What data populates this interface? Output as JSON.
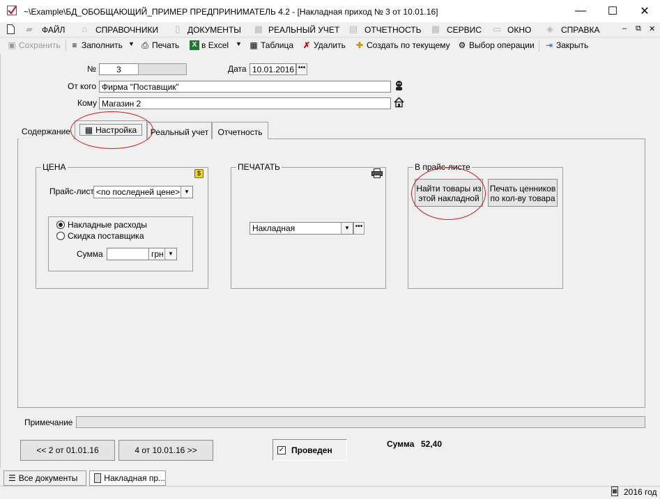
{
  "window": {
    "title": "~\\Example\\БД_ОБОБЩАЮЩИЙ_ПРИМЕР  ПРЕДПРИНИМАТЕЛЬ 4.2 - [Накладная приход № 3 от 10.01.16]",
    "minimize": "—",
    "maximize": "☐",
    "close": "✕"
  },
  "menu": {
    "items": [
      {
        "label": "ФАЙЛ"
      },
      {
        "label": "СПРАВОЧНИКИ"
      },
      {
        "label": "ДОКУМЕНТЫ"
      },
      {
        "label": "РЕАЛЬНЫЙ УЧЕТ"
      },
      {
        "label": "ОТЧЕТНОСТЬ"
      },
      {
        "label": "СЕРВИС"
      },
      {
        "label": "ОКНО"
      },
      {
        "label": "СПРАВКА"
      }
    ],
    "mdi_minimize": "–",
    "mdi_restore": "⧉",
    "mdi_close": "✕"
  },
  "toolbar": {
    "save": "Сохранить",
    "fill": "Заполнить",
    "print": "Печать",
    "excel": "в Excel",
    "table": "Таблица",
    "delete": "Удалить",
    "create": "Создать по текущему",
    "select_op": "Выбор операции",
    "close": "Закрыть"
  },
  "form": {
    "number_label": "№",
    "number_value": "3",
    "date_label": "Дата",
    "date_value": "10.01.2016",
    "from_label": "От кого",
    "from_value": "Фирма \"Поставщик\"",
    "to_label": "Кому",
    "to_value": "Магазин 2"
  },
  "tabs": [
    {
      "label": "Содержание"
    },
    {
      "label": "Настройка"
    },
    {
      "label": "Реальный учет"
    },
    {
      "label": "Отчетность"
    }
  ],
  "price_group": {
    "title": "ЦЕНА",
    "pricelist_label": "Прайс-лист",
    "pricelist_value": "<по последней цене>",
    "radio_overhead": "Накладные расходы",
    "radio_discount": "Скидка поставщика",
    "sum_label": "Сумма",
    "sum_value": "",
    "currency": "грн"
  },
  "print_group": {
    "title": "ПЕЧАТАТЬ",
    "form_value": "Накладная"
  },
  "pricelist_group": {
    "title": "В прайс-листе",
    "find_button": "Найти товары из этой накладной",
    "print_tags_button": "Печать ценников по кол-ву товара"
  },
  "footer": {
    "note_label": "Примечание",
    "note_value": "",
    "prev_button": "<< 2 от 01.01.16",
    "next_button": "4 от 10.01.16 >>",
    "posted_label": "Проведен",
    "sum_label": "Сумма",
    "sum_value": "52,40"
  },
  "taskbar": {
    "all_docs": "Все документы",
    "current_doc": "Накладная пр..."
  },
  "status": {
    "year": "2016 год"
  },
  "colors": {
    "window_bg": "#f0f0f0",
    "highlight_ellipse": "#cc1a1a",
    "app_icon": "#c0202a"
  }
}
